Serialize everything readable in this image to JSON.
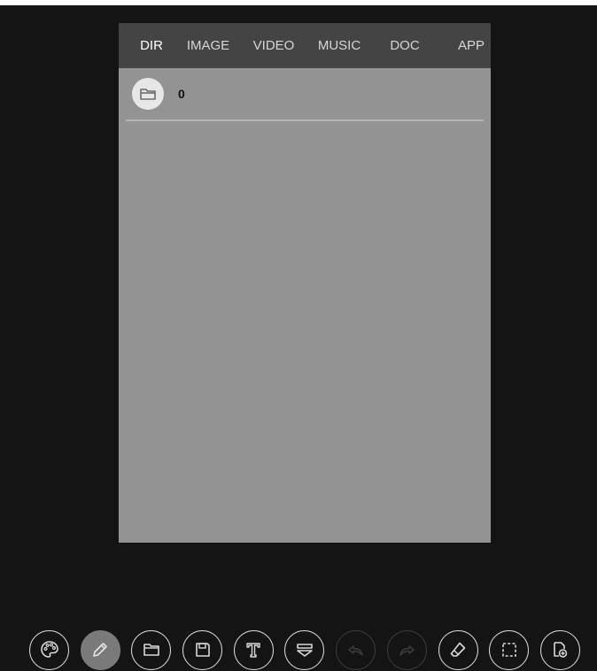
{
  "tabs": [
    {
      "label": "DIR",
      "active": true
    },
    {
      "label": "IMAGE",
      "active": false
    },
    {
      "label": "VIDEO",
      "active": false
    },
    {
      "label": "MUSIC",
      "active": false
    },
    {
      "label": "DOC",
      "active": false
    },
    {
      "label": "APP",
      "active": false
    }
  ],
  "list": {
    "items": [
      {
        "icon": "folder-icon",
        "label": "0"
      }
    ]
  },
  "toolbar": {
    "buttons": [
      {
        "icon": "palette-icon",
        "state": "normal"
      },
      {
        "icon": "pencil-icon",
        "state": "active"
      },
      {
        "icon": "folder-icon",
        "state": "normal"
      },
      {
        "icon": "save-icon",
        "state": "normal"
      },
      {
        "icon": "text-icon",
        "state": "normal"
      },
      {
        "icon": "layers-icon",
        "state": "normal"
      },
      {
        "icon": "undo-icon",
        "state": "disabled"
      },
      {
        "icon": "redo-icon",
        "state": "disabled"
      },
      {
        "icon": "eraser-icon",
        "state": "normal"
      },
      {
        "icon": "select-icon",
        "state": "normal"
      },
      {
        "icon": "new-page-icon",
        "state": "normal"
      }
    ]
  },
  "colors": {
    "background": "#141414",
    "panel": "#939393",
    "tab_bar": "#444444",
    "active_button": "#7a7a7a",
    "icon_stroke": "#d9d9d9",
    "disabled_stroke": "#3c3c3c"
  }
}
